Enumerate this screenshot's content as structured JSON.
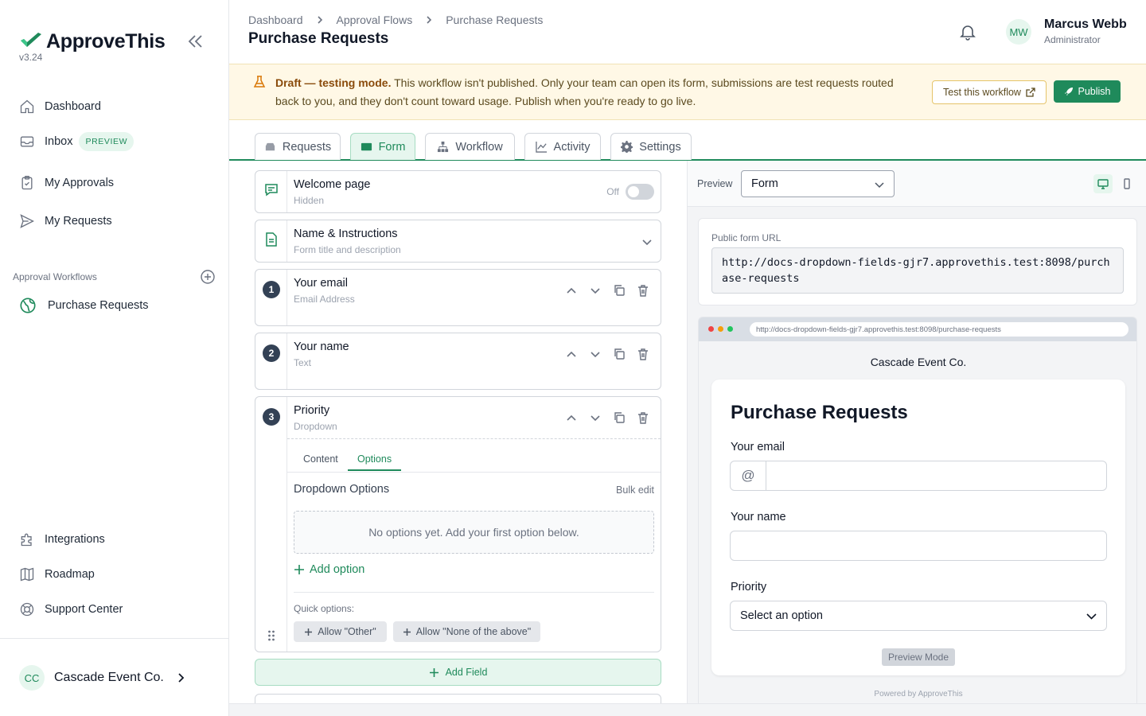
{
  "app": {
    "name": "ApproveThis",
    "version": "v3.24",
    "brand_color": "#1f8a5b"
  },
  "sidebar": {
    "nav": [
      {
        "label": "Dashboard",
        "icon": "home-icon"
      },
      {
        "label": "Inbox",
        "icon": "inbox-icon",
        "badge": "PREVIEW"
      },
      {
        "label": "My Approvals",
        "icon": "clipboard-icon"
      },
      {
        "label": "My Requests",
        "icon": "send-icon"
      }
    ],
    "section_label": "Approval Workflows",
    "workflows": [
      {
        "label": "Purchase Requests",
        "icon": "globe-icon"
      }
    ],
    "bottom_nav": [
      {
        "label": "Integrations",
        "icon": "puzzle-icon"
      },
      {
        "label": "Roadmap",
        "icon": "map-icon"
      },
      {
        "label": "Support Center",
        "icon": "lifebuoy-icon"
      }
    ],
    "org": {
      "initials": "CC",
      "name": "Cascade Event Co."
    }
  },
  "header": {
    "breadcrumb": [
      "Dashboard",
      "Approval Flows",
      "Purchase Requests"
    ],
    "title": "Purchase Requests",
    "user": {
      "initials": "MW",
      "name": "Marcus Webb",
      "role": "Administrator"
    }
  },
  "banner": {
    "strong": "Draft — testing mode.",
    "text": " This workflow isn't published. Only your team can open its form, submissions are test requests routed back to you, and they don't count toward usage. Publish when you're ready to go live.",
    "test_button": "Test this workflow",
    "publish_button": "Publish"
  },
  "tabs": [
    {
      "label": "Requests",
      "icon": "inbox-tray-icon"
    },
    {
      "label": "Form",
      "icon": "form-icon",
      "active": true
    },
    {
      "label": "Workflow",
      "icon": "workflow-icon"
    },
    {
      "label": "Activity",
      "icon": "chart-line-icon"
    },
    {
      "label": "Settings",
      "icon": "gear-icon"
    }
  ],
  "editor": {
    "welcome": {
      "title": "Welcome page",
      "subtitle": "Hidden",
      "toggle_label": "Off",
      "enabled": false
    },
    "name_instructions": {
      "title": "Name & Instructions",
      "subtitle": "Form title and description"
    },
    "fields": [
      {
        "number": "1",
        "title": "Your email",
        "type": "Email Address"
      },
      {
        "number": "2",
        "title": "Your name",
        "type": "Text"
      },
      {
        "number": "3",
        "title": "Priority",
        "type": "Dropdown"
      }
    ],
    "priority_panel": {
      "subtabs": [
        "Content",
        "Options"
      ],
      "active_subtab": "Options",
      "options_title": "Dropdown Options",
      "bulk_edit": "Bulk edit",
      "empty_message": "No options yet. Add your first option below.",
      "add_option": "Add option",
      "quick_label": "Quick options:",
      "quick_options": [
        "Allow \"Other\"",
        "Allow \"None of the above\""
      ]
    },
    "add_field": "Add Field"
  },
  "preview": {
    "label": "Preview",
    "select_value": "Form",
    "url_label": "Public form URL",
    "url": "http://docs-dropdown-fields-gjr7.approvethis.test:8098/purchase-requests",
    "browser_url": "http://docs-dropdown-fields-gjr7.approvethis.test:8098/purchase-requests",
    "org_name": "Cascade Event Co.",
    "form": {
      "title": "Purchase Requests",
      "email_label": "Your email",
      "email_prefix": "@",
      "name_label": "Your name",
      "priority_label": "Priority",
      "priority_placeholder": "Select an option",
      "mode_badge": "Preview Mode"
    },
    "powered_by": "Powered by ApproveThis"
  }
}
